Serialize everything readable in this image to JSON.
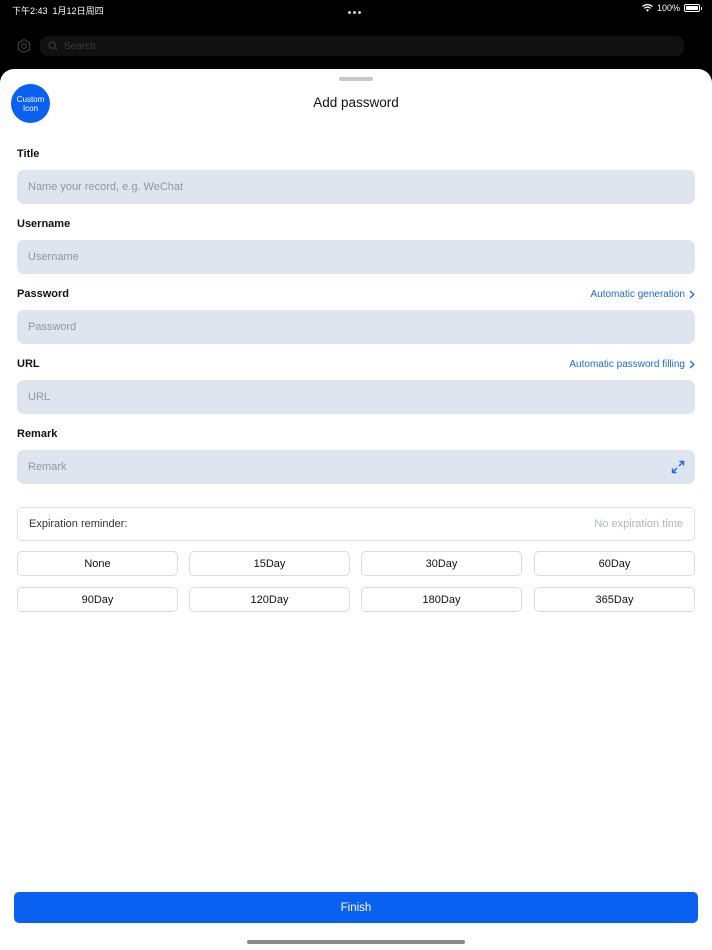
{
  "status_bar": {
    "time": "下午2:43",
    "date": "1月12日周四",
    "battery": "100%"
  },
  "background_app": {
    "search_placeholder": "Search"
  },
  "sheet": {
    "title": "Add password",
    "custom_icon_label": "Custom Icon",
    "fields": {
      "title": {
        "label": "Title",
        "placeholder": "Name your record, e.g. WeChat"
      },
      "username": {
        "label": "Username",
        "placeholder": "Username"
      },
      "password": {
        "label": "Password",
        "placeholder": "Password",
        "link": "Automatic generation"
      },
      "url": {
        "label": "URL",
        "placeholder": "URL",
        "link": "Automatic password filling"
      },
      "remark": {
        "label": "Remark",
        "placeholder": "Remark"
      }
    },
    "expiration": {
      "label": "Expiration reminder:",
      "value": "No expiration time",
      "options": [
        "None",
        "15Day",
        "30Day",
        "60Day",
        "90Day",
        "120Day",
        "180Day",
        "365Day"
      ]
    },
    "finish_label": "Finish"
  },
  "colors": {
    "accent": "#0A60F0",
    "link": "#1A6AD8",
    "input_bg": "#DFE5EE"
  },
  "icons": [
    "wifi-icon",
    "battery-icon",
    "gear-icon",
    "search-icon",
    "chevron-right-icon",
    "expand-icon"
  ]
}
